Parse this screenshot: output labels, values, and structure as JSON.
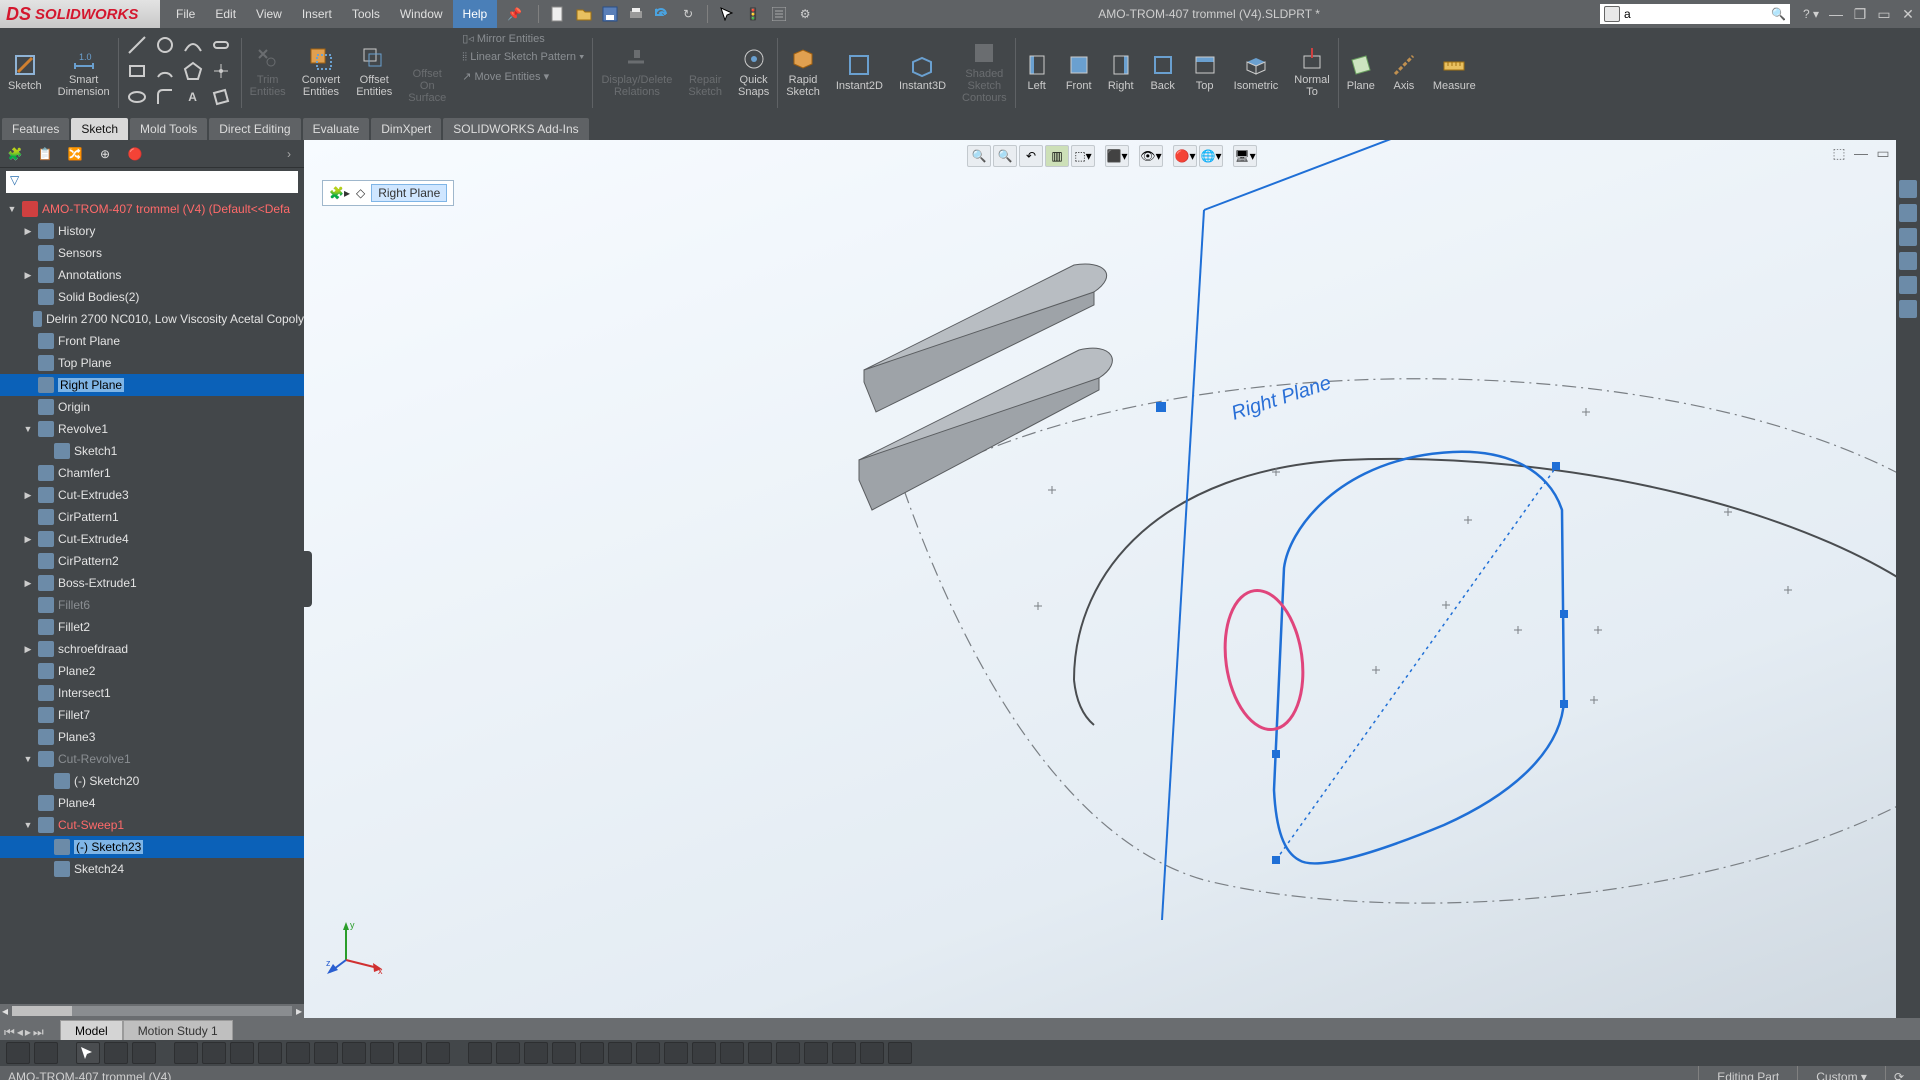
{
  "app": {
    "brand": "SOLIDWORKS",
    "doc_title": "AMO-TROM-407 trommel (V4).SLDPRT *"
  },
  "menu": {
    "items": [
      "File",
      "Edit",
      "View",
      "Insert",
      "Tools",
      "Window",
      "Help"
    ],
    "highlighted": 6
  },
  "search": {
    "value": "a"
  },
  "ribbon": {
    "sketch": "Sketch",
    "smart_dimension": "Smart\nDimension",
    "trim": "Trim\nEntities",
    "convert": "Convert\nEntities",
    "offset": "Offset\nEntities",
    "offset_surface": "Offset\nOn\nSurface",
    "mirror": "Mirror Entities",
    "lsp": "Linear Sketch Pattern",
    "move": "Move Entities",
    "disp_del": "Display/Delete\nRelations",
    "repair": "Repair\nSketch",
    "quick": "Quick\nSnaps",
    "rapid": "Rapid\nSketch",
    "i2d": "Instant2D",
    "i3d": "Instant3D",
    "shaded": "Shaded\nSketch\nContours",
    "views": [
      "Left",
      "Front",
      "Right",
      "Back",
      "Top",
      "Isometric"
    ],
    "normal": "Normal\nTo",
    "plane": "Plane",
    "axis": "Axis",
    "measure": "Measure"
  },
  "tabs": [
    "Features",
    "Sketch",
    "Mold Tools",
    "Direct Editing",
    "Evaluate",
    "DimXpert",
    "SOLIDWORKS Add-Ins"
  ],
  "active_tab": 1,
  "crumb": {
    "label": "Right Plane"
  },
  "tree": {
    "root": "AMO-TROM-407 trommel (V4)  (Default<<Defa",
    "items": [
      {
        "t": "History",
        "i": 1,
        "exp": "▶"
      },
      {
        "t": "Sensors",
        "i": 1
      },
      {
        "t": "Annotations",
        "i": 1,
        "exp": "▶"
      },
      {
        "t": "Solid Bodies(2)",
        "i": 1
      },
      {
        "t": "Delrin 2700 NC010, Low Viscosity Acetal Copoly",
        "i": 1
      },
      {
        "t": "Front Plane",
        "i": 1
      },
      {
        "t": "Top Plane",
        "i": 1
      },
      {
        "t": "Right Plane",
        "i": 1,
        "sel": true
      },
      {
        "t": "Origin",
        "i": 1
      },
      {
        "t": "Revolve1",
        "i": 1,
        "exp": "▼"
      },
      {
        "t": "Sketch1",
        "i": 2
      },
      {
        "t": "Chamfer1",
        "i": 1
      },
      {
        "t": "Cut-Extrude3",
        "i": 1,
        "exp": "▶"
      },
      {
        "t": "CirPattern1",
        "i": 1
      },
      {
        "t": "Cut-Extrude4",
        "i": 1,
        "exp": "▶"
      },
      {
        "t": "CirPattern2",
        "i": 1
      },
      {
        "t": "Boss-Extrude1",
        "i": 1,
        "exp": "▶"
      },
      {
        "t": "Fillet6",
        "i": 1,
        "dis": true
      },
      {
        "t": "Fillet2",
        "i": 1
      },
      {
        "t": "schroefdraad",
        "i": 1,
        "exp": "▶"
      },
      {
        "t": "Plane2",
        "i": 1
      },
      {
        "t": "Intersect1",
        "i": 1
      },
      {
        "t": "Fillet7",
        "i": 1
      },
      {
        "t": "Plane3",
        "i": 1
      },
      {
        "t": "Cut-Revolve1",
        "i": 1,
        "dis": true,
        "exp": "▼"
      },
      {
        "t": "(-) Sketch20",
        "i": 2
      },
      {
        "t": "Plane4",
        "i": 1
      },
      {
        "t": "Cut-Sweep1",
        "i": 1,
        "err": true,
        "exp": "▼"
      },
      {
        "t": "(-) Sketch23",
        "i": 2,
        "sel": true
      },
      {
        "t": "Sketch24",
        "i": 2
      }
    ]
  },
  "viewport": {
    "plane_label": "Right Plane"
  },
  "bottom_tabs": [
    "Model",
    "Motion Study 1"
  ],
  "status": {
    "left": "AMO-TROM-407 trommel (V4)",
    "mode": "Editing Part",
    "custom": "Custom"
  }
}
